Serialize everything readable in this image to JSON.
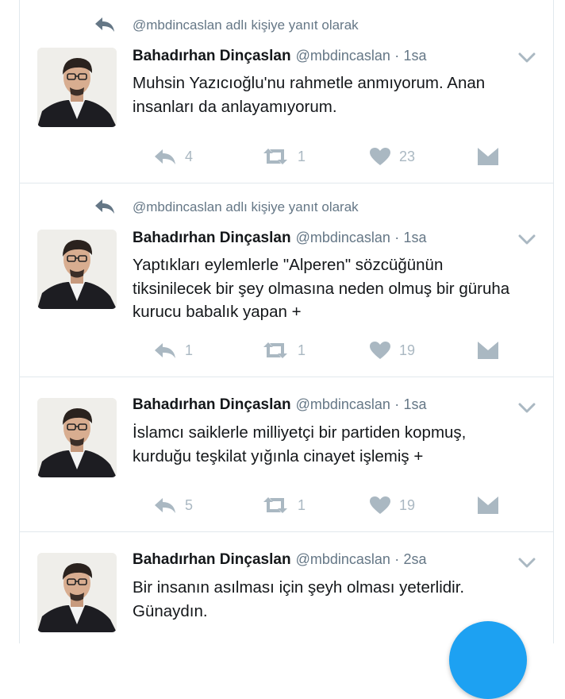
{
  "colors": {
    "accent": "#1da1f2",
    "muted": "#657786",
    "icon": "#aab8c2"
  },
  "tweets": [
    {
      "reply_context": "@mbdincaslan adlı kişiye yanıt olarak",
      "name": "Bahadırhan Dinçaslan",
      "handle": "@mbdincaslan",
      "separator": "·",
      "time": "1sa",
      "lines": [
        "Muhsin Yazıcıoğlu'nu rahmetle anmıyorum. Anan",
        "insanları da anlayamıyorum."
      ],
      "replies": "4",
      "retweets": "1",
      "likes": "23"
    },
    {
      "reply_context": "@mbdincaslan adlı kişiye yanıt olarak",
      "name": "Bahadırhan Dinçaslan",
      "handle": "@mbdincaslan",
      "separator": "·",
      "time": "1sa",
      "lines": [
        "Yaptıkları eylemlerle \"Alperen\" sözcüğünün",
        "tiksinilecek bir şey olmasına neden olmuş bir güruha",
        "kurucu babalık yapan +"
      ],
      "replies": "1",
      "retweets": "1",
      "likes": "19"
    },
    {
      "name": "Bahadırhan Dinçaslan",
      "handle": "@mbdincaslan",
      "separator": "·",
      "time": "1sa",
      "lines": [
        "İslamcı saiklerle milliyetçi bir partiden kopmuş,",
        "kurduğu teşkilat yığınla cinayet işlemiş +"
      ],
      "replies": "5",
      "retweets": "1",
      "likes": "19"
    },
    {
      "name": "Bahadırhan Dinçaslan",
      "handle": "@mbdincaslan",
      "separator": "·",
      "time": "2sa",
      "lines": [
        "Bir insanın asılması için şeyh olması yeterlidir.",
        "Günaydın."
      ]
    }
  ]
}
